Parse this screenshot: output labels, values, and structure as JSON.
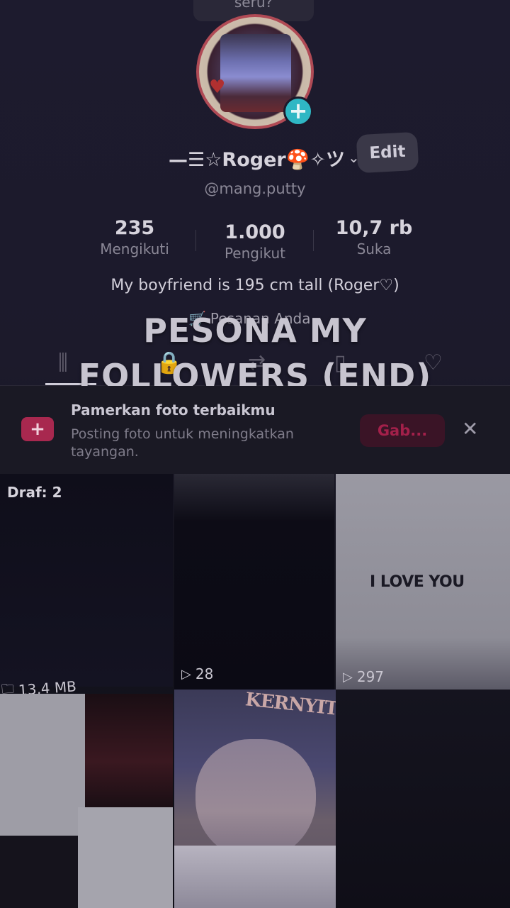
{
  "top_pill": "seru?",
  "profile": {
    "username": "—☰☆Roger🍄✧ツ",
    "handle": "@mang.putty",
    "edit_label": "Edit",
    "bio": "My boyfriend is 195 cm tall (Roger♡)",
    "orders_label": "Pesanan Anda"
  },
  "stats": [
    {
      "value": "235",
      "label": "Mengikuti"
    },
    {
      "value": "1.000",
      "label": "Pengikut"
    },
    {
      "value": "10,7 rb",
      "label": "Suka"
    }
  ],
  "overlay_title": "PESONA MY FOLLOWERS (END)",
  "tabs": [
    "grid-icon",
    "lock-icon",
    "repost-icon",
    "bookmark-icon",
    "heart-icon"
  ],
  "promo": {
    "title": "Pamerkan foto terbaikmu",
    "subtitle": "Posting foto untuk meningkatkan tayangan.",
    "join_label": "Gab..."
  },
  "grid": {
    "draft_label": "Draf: 2",
    "item2_views": "28",
    "item3_views": "297",
    "item3_caption": "I LOVE YOU",
    "item4_size": "13,4 MB",
    "item5_caption": "KERNYIT"
  },
  "colors": {
    "accent": "#a8284f",
    "add_button": "#2fb7c4"
  }
}
